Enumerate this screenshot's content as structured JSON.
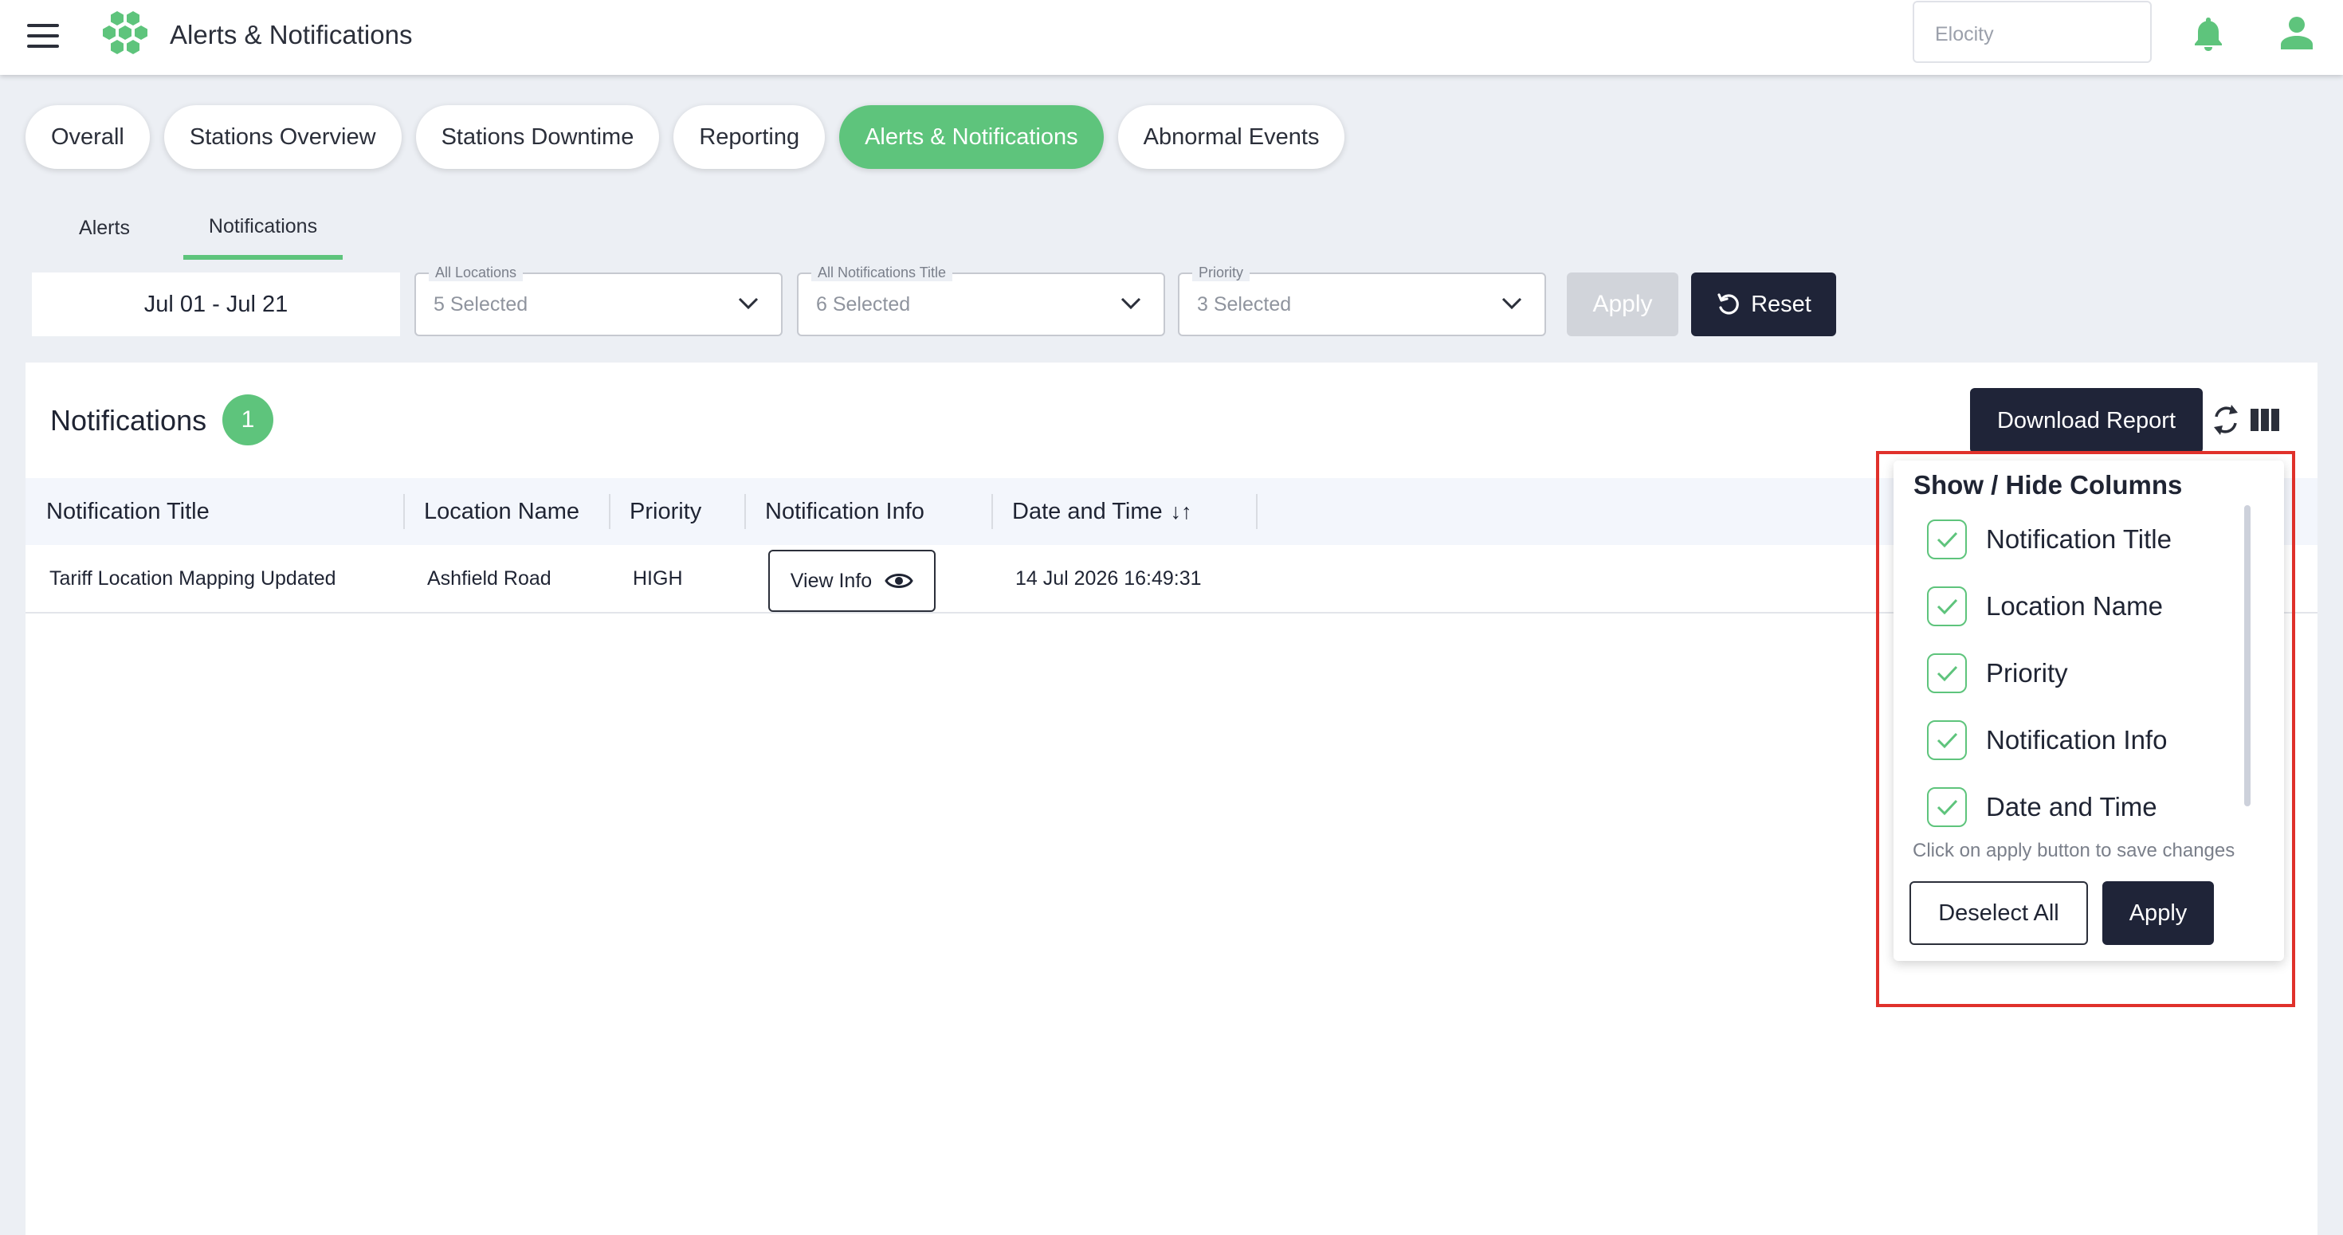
{
  "header": {
    "app_title": "Alerts & Notifications",
    "org_select_value": "Elocity"
  },
  "main_tabs": [
    {
      "label": "Overall",
      "active": false
    },
    {
      "label": "Stations Overview",
      "active": false
    },
    {
      "label": "Stations Downtime",
      "active": false
    },
    {
      "label": "Reporting",
      "active": false
    },
    {
      "label": "Alerts & Notifications",
      "active": true
    },
    {
      "label": "Abnormal Events",
      "active": false
    }
  ],
  "sub_tabs": [
    {
      "label": "Alerts",
      "active": false
    },
    {
      "label": "Notifications",
      "active": true
    }
  ],
  "filters": {
    "date_range": "Jul 01 - Jul 21",
    "locations": {
      "label": "All Locations",
      "value": "5 Selected"
    },
    "titles": {
      "label": "All Notifications Title",
      "value": "6 Selected"
    },
    "priority": {
      "label": "Priority",
      "value": "3 Selected"
    },
    "apply_label": "Apply",
    "reset_label": "Reset"
  },
  "panel": {
    "title": "Notifications",
    "count": "1",
    "download_label": "Download Report"
  },
  "table": {
    "columns": [
      "Notification Title",
      "Location Name",
      "Priority",
      "Notification Info",
      "Date and Time"
    ],
    "sort_indicator": "↓↑",
    "rows": [
      {
        "title": "Tariff Location Mapping Updated",
        "location": "Ashfield Road",
        "priority": "HIGH",
        "info_button": "View Info",
        "datetime": "14 Jul 2026 16:49:31"
      }
    ]
  },
  "column_menu": {
    "title": "Show / Hide Columns",
    "options": [
      {
        "label": "Notification Title",
        "checked": true
      },
      {
        "label": "Location Name",
        "checked": true
      },
      {
        "label": "Priority",
        "checked": true
      },
      {
        "label": "Notification Info",
        "checked": true
      },
      {
        "label": "Date and Time",
        "checked": true
      }
    ],
    "hint": "Click on apply button to save changes",
    "deselect_label": "Deselect All",
    "apply_label": "Apply"
  },
  "colors": {
    "accent_green": "#5ec47c",
    "dark_navy": "#1f2438",
    "highlight_red": "#e0312b"
  },
  "icons": [
    "hamburger-menu-icon",
    "logo-icon",
    "bell-icon",
    "user-icon",
    "chevron-down-icon",
    "reset-icon",
    "eye-icon",
    "refresh-icon",
    "columns-icon",
    "checkmark-icon"
  ]
}
